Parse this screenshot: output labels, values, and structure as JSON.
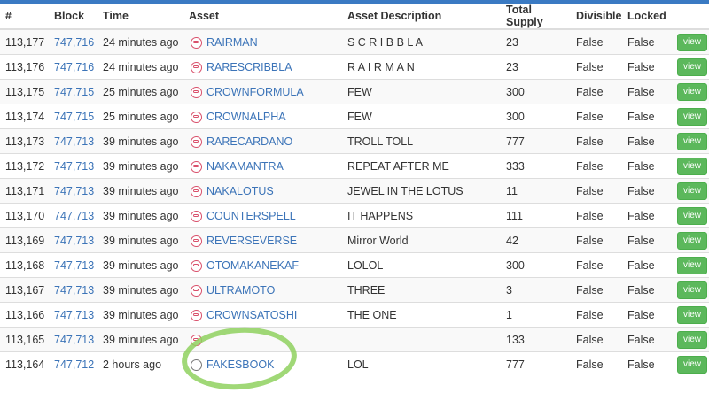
{
  "headers": [
    "#",
    "Block",
    "Time",
    "Asset",
    "Asset Description",
    "Total Supply",
    "Divisible",
    "Locked",
    ""
  ],
  "view_label": "view",
  "rows": [
    {
      "num": "113,177",
      "block": "747,716",
      "time": "24 minutes ago",
      "asset": "RAIRMAN",
      "desc": "S C R I B B L A",
      "supply": "23",
      "divisible": "False",
      "locked": "False"
    },
    {
      "num": "113,176",
      "block": "747,716",
      "time": "24 minutes ago",
      "asset": "RARESCRIBBLA",
      "desc": "R A I R M A N",
      "supply": "23",
      "divisible": "False",
      "locked": "False"
    },
    {
      "num": "113,175",
      "block": "747,715",
      "time": "25 minutes ago",
      "asset": "CROWNFORMULA",
      "desc": "FEW",
      "supply": "300",
      "divisible": "False",
      "locked": "False"
    },
    {
      "num": "113,174",
      "block": "747,715",
      "time": "25 minutes ago",
      "asset": "CROWNALPHA",
      "desc": "FEW",
      "supply": "300",
      "divisible": "False",
      "locked": "False"
    },
    {
      "num": "113,173",
      "block": "747,713",
      "time": "39 minutes ago",
      "asset": "RARECARDANO",
      "desc": "TROLL TOLL",
      "supply": "777",
      "divisible": "False",
      "locked": "False"
    },
    {
      "num": "113,172",
      "block": "747,713",
      "time": "39 minutes ago",
      "asset": "NAKAMANTRA",
      "desc": "REPEAT AFTER ME",
      "supply": "333",
      "divisible": "False",
      "locked": "False"
    },
    {
      "num": "113,171",
      "block": "747,713",
      "time": "39 minutes ago",
      "asset": "NAKALOTUS",
      "desc": "JEWEL IN THE LOTUS",
      "supply": "11",
      "divisible": "False",
      "locked": "False"
    },
    {
      "num": "113,170",
      "block": "747,713",
      "time": "39 minutes ago",
      "asset": "COUNTERSPELL",
      "desc": "IT HAPPENS",
      "supply": "111",
      "divisible": "False",
      "locked": "False"
    },
    {
      "num": "113,169",
      "block": "747,713",
      "time": "39 minutes ago",
      "asset": "REVERSEVERSE",
      "desc": "Mirror World",
      "supply": "42",
      "divisible": "False",
      "locked": "False"
    },
    {
      "num": "113,168",
      "block": "747,713",
      "time": "39 minutes ago",
      "asset": "OTOMAKANEKAF",
      "desc": "LOLOL",
      "supply": "300",
      "divisible": "False",
      "locked": "False"
    },
    {
      "num": "113,167",
      "block": "747,713",
      "time": "39 minutes ago",
      "asset": "ULTRAMOTO",
      "desc": "THREE",
      "supply": "3",
      "divisible": "False",
      "locked": "False"
    },
    {
      "num": "113,166",
      "block": "747,713",
      "time": "39 minutes ago",
      "asset": "CROWNSATOSHI",
      "desc": "THE ONE",
      "supply": "1",
      "divisible": "False",
      "locked": "False"
    },
    {
      "num": "113,165",
      "block": "747,713",
      "time": "39 minutes ago",
      "asset": "",
      "desc": "",
      "supply": "133",
      "divisible": "False",
      "locked": "False"
    },
    {
      "num": "113,164",
      "block": "747,712",
      "time": "2 hours ago",
      "asset": "FAKESBOOK",
      "desc": "LOL",
      "supply": "777",
      "divisible": "False",
      "locked": "False"
    }
  ]
}
